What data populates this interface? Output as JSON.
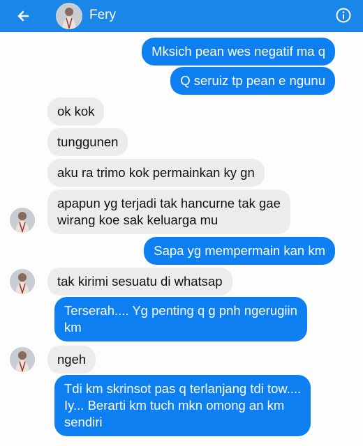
{
  "header": {
    "contact_name": "Fery",
    "bar_color": "#1a87e8",
    "back_icon": "arrow-left-icon",
    "info_icon": "info-circle-icon"
  },
  "messages": [
    {
      "direction": "outgoing",
      "text": "Mksich pean wes negatif ma q"
    },
    {
      "direction": "outgoing",
      "text": "Q seruiz tp pean e ngunu"
    },
    {
      "direction": "incoming",
      "text": "ok kok"
    },
    {
      "direction": "incoming",
      "text": "tunggunen"
    },
    {
      "direction": "incoming",
      "text": "aku ra trimo kok permainkan ky gn"
    },
    {
      "direction": "incoming",
      "lines": [
        "apapun yg terjadi tak hancurne tak gae",
        "wirang koe sak keluarga mu"
      ]
    },
    {
      "direction": "outgoing",
      "text": "Sapa yg mempermain kan km"
    },
    {
      "direction": "incoming",
      "text": "tak kirimi sesuatu di whatsap"
    },
    {
      "direction": "outgoing",
      "lines": [
        "Terserah.... Yg penting q g pnh ngerugiin",
        "km"
      ]
    },
    {
      "direction": "incoming",
      "text": "ngeh"
    },
    {
      "direction": "outgoing",
      "lines": [
        "Tdi km skrinsot pas q terlanjang tdi tow....",
        "Iy... Berarti km tuch mkn omong an km",
        "sendiri"
      ]
    }
  ],
  "colors": {
    "incoming_bubble": "#ececec",
    "outgoing_bubble": "#0d7ff0",
    "background": "#fdfdfd"
  }
}
